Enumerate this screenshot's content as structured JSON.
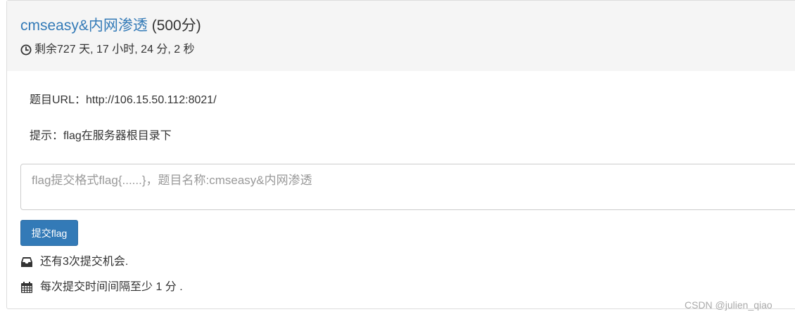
{
  "challenge": {
    "title": "cmseasy&内网渗透",
    "points": "(500分)",
    "countdown": "剩余727 天, 17 小时, 24 分, 2 秒"
  },
  "body": {
    "url_line": "题目URL：http://106.15.50.112:8021/",
    "hint_line": "提示：flag在服务器根目录下",
    "flag_input": {
      "value": "",
      "placeholder": "flag提交格式flag{......}，题目名称:cmseasy&内网渗透"
    },
    "submit_label": "提交flag",
    "attempts_text": "还有3次提交机会.",
    "interval_text": "每次提交时间间隔至少 1 分 ."
  },
  "watermark": "CSDN @julien_qiao",
  "colors": {
    "link": "#337ab7",
    "button": "#337ab7",
    "heading_bg": "#f5f5f5"
  },
  "icons": {
    "countdown": "clock-icon",
    "attempts": "inbox-icon",
    "interval": "calendar-icon"
  }
}
